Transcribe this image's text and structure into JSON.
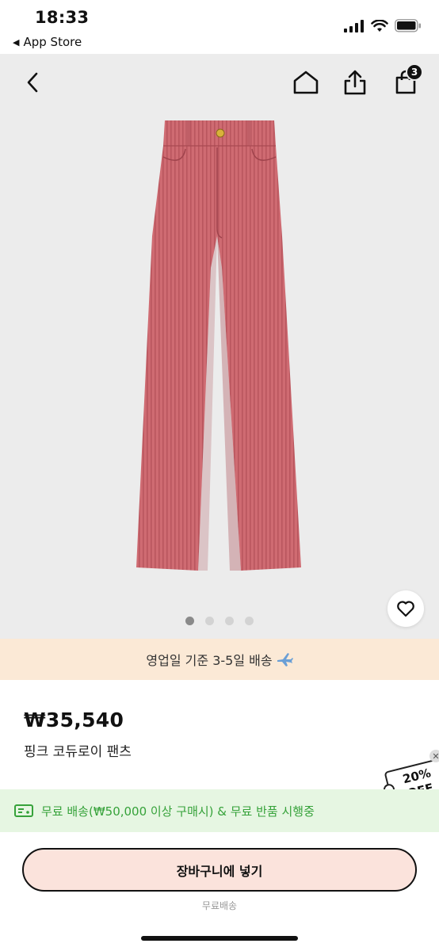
{
  "status_bar": {
    "time": "18:33",
    "back_app": "App Store",
    "icons": [
      "signal-icon",
      "wifi-icon",
      "battery-icon"
    ]
  },
  "nav": {
    "icons": [
      "back-arrow-icon",
      "home-icon",
      "share-icon",
      "shopping-bag-icon"
    ],
    "cart_count": "3"
  },
  "gallery": {
    "image": "pink-corduroy-pants",
    "total_images": 4,
    "active_index": 0
  },
  "shipping_banner": {
    "text": "영업일 기준 3-5일 배송",
    "icon": "airplane-icon"
  },
  "product": {
    "price": "₩35,540",
    "name": "핑크 코듀로이 팬츠"
  },
  "coupon": {
    "text_top": "20%",
    "text_bottom": "OFF"
  },
  "promo": {
    "text": "무료 배송(₩50,000 이상 구매시) & 무료 반품 시행중",
    "icon": "delivery-truck-icon"
  },
  "cta": {
    "label": "장바구니에 넣기",
    "sublabel": "무료배송"
  },
  "colors": {
    "accent_green": "#36a23a",
    "banner_peach": "#fbe9d6",
    "button_pink": "#fbe3dc",
    "pants_pink": "#cf6b72"
  }
}
